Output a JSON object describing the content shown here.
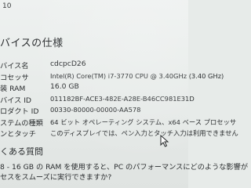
{
  "window": {
    "title": "10"
  },
  "device_spec": {
    "header": "バイスの仕様",
    "rows": [
      {
        "label": "バイス名",
        "value": "cdcpcD26"
      },
      {
        "label": "コセッサ",
        "value": "Intel(R) Core(TM) i7-3770 CPU @ 3.40GHz (3.40 GHz)"
      },
      {
        "label": "装 RAM",
        "value": "16.0 GB"
      },
      {
        "label": "バイス ID",
        "value": "011182BF-ACE3-482E-A28E-B46CC981E31D"
      },
      {
        "label": "ロダクト ID",
        "value": "00330-80000-00000-AA578"
      },
      {
        "label": "ステムの種類",
        "value": "64 ビット オペレーティング システム、x64 ベース プロセッサ"
      },
      {
        "label": "ンとタッチ",
        "value": "このディスプレイでは、ペン入力とタッチ入力は利用できません"
      }
    ]
  },
  "faq": {
    "header": "くある質問",
    "line1": "8 - 16 GB の RAM を使用すると、PC のパフォーマンスにどのような影響が",
    "line2": "セスをスムーズに実行できますか?"
  }
}
